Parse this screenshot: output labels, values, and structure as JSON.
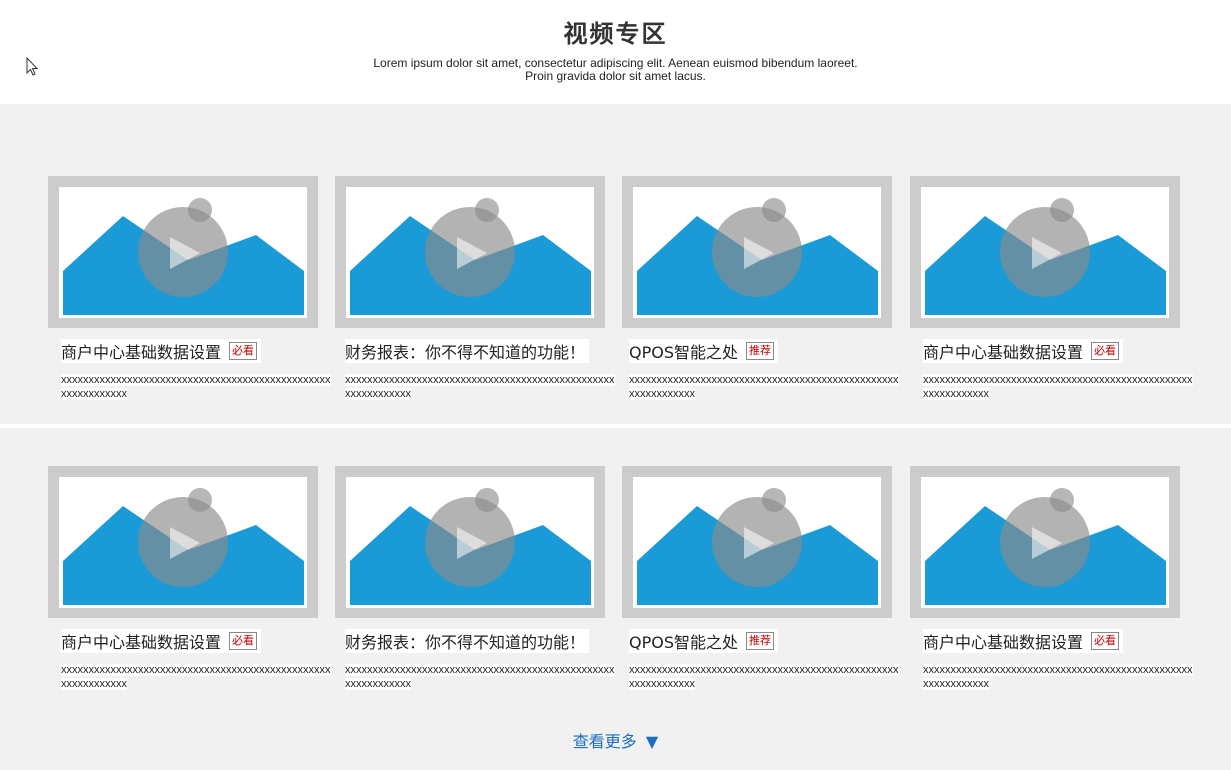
{
  "header": {
    "title": "视频专区",
    "subtitle_line1": "Lorem ipsum dolor sit amet, consectetur adipiscing elit. Aenean euismod bibendum laoreet.",
    "subtitle_line2": "Proin gravida dolor sit amet lacus."
  },
  "colors": {
    "band": "#f1f1f1",
    "mountain": "#1a9bd7",
    "badge_text": "#c00000",
    "more_link": "#1a6fc4"
  },
  "rows": [
    {
      "cards": [
        {
          "title": "商户中心基础数据设置",
          "badge": "必看",
          "desc": "xxxxxxxxxxxxxxxxxxxxxxxxxxxxxxxxxxxxxxxxxxxxxxxxxxxxxxxxxxxxx"
        },
        {
          "title": "财务报表：你不得不知道的功能！",
          "badge": "",
          "desc": "xxxxxxxxxxxxxxxxxxxxxxxxxxxxxxxxxxxxxxxxxxxxxxxxxxxxxxxxxxxxx"
        },
        {
          "title": "QPOS智能之处",
          "badge": "推荐",
          "desc": "xxxxxxxxxxxxxxxxxxxxxxxxxxxxxxxxxxxxxxxxxxxxxxxxxxxxxxxxxxxxx"
        },
        {
          "title": "商户中心基础数据设置",
          "badge": "必看",
          "desc": "xxxxxxxxxxxxxxxxxxxxxxxxxxxxxxxxxxxxxxxxxxxxxxxxxxxxxxxxxxxxx"
        }
      ]
    },
    {
      "cards": [
        {
          "title": "商户中心基础数据设置",
          "badge": "必看",
          "desc": "xxxxxxxxxxxxxxxxxxxxxxxxxxxxxxxxxxxxxxxxxxxxxxxxxxxxxxxxxxxxx"
        },
        {
          "title": "财务报表：你不得不知道的功能！",
          "badge": "",
          "desc": "xxxxxxxxxxxxxxxxxxxxxxxxxxxxxxxxxxxxxxxxxxxxxxxxxxxxxxxxxxxxx"
        },
        {
          "title": "QPOS智能之处",
          "badge": "推荐",
          "desc": "xxxxxxxxxxxxxxxxxxxxxxxxxxxxxxxxxxxxxxxxxxxxxxxxxxxxxxxxxxxxx"
        },
        {
          "title": "商户中心基础数据设置",
          "badge": "必看",
          "desc": "xxxxxxxxxxxxxxxxxxxxxxxxxxxxxxxxxxxxxxxxxxxxxxxxxxxxxxxxxxxxx"
        }
      ]
    }
  ],
  "more": {
    "label": "查看更多",
    "icon": "caret-down-icon"
  }
}
